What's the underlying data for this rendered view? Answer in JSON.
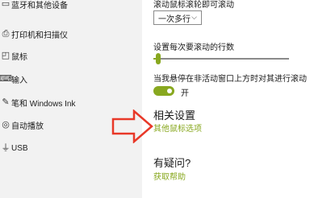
{
  "sidebar": {
    "items": [
      {
        "icon": "bluetooth-device-icon",
        "glyph": "▭",
        "label": "蓝牙和其他设备"
      },
      {
        "icon": "printer-icon",
        "glyph": "⎙",
        "label": "打印机和扫描仪"
      },
      {
        "icon": "mouse-icon",
        "glyph": "◰",
        "label": "鼠标"
      },
      {
        "icon": "keyboard-icon",
        "glyph": "⌨",
        "label": "输入"
      },
      {
        "icon": "pen-icon",
        "glyph": "✎",
        "label": "笔和 Windows Ink"
      },
      {
        "icon": "autoplay-icon",
        "glyph": "◎",
        "label": "自动播放"
      },
      {
        "icon": "usb-icon",
        "glyph": "⏚",
        "label": "USB"
      }
    ]
  },
  "main": {
    "wheel_scroll_label": "滚动鼠标滚轮即可滚动",
    "wheel_scroll_value": "一次多行",
    "lines_label": "设置每次要滚动的行数",
    "lines_value": 3,
    "inactive_scroll_label": "当我悬停在非活动窗口上方时对其进行滚动",
    "inactive_scroll_state": "开",
    "related_heading": "相关设置",
    "related_link": "其他鼠标选项",
    "question_heading": "有疑问?",
    "help_link": "获取帮助"
  },
  "colors": {
    "accent": "#88a81f",
    "arrow": "#e83828",
    "sidebar_bg": "#f2f2f2"
  }
}
